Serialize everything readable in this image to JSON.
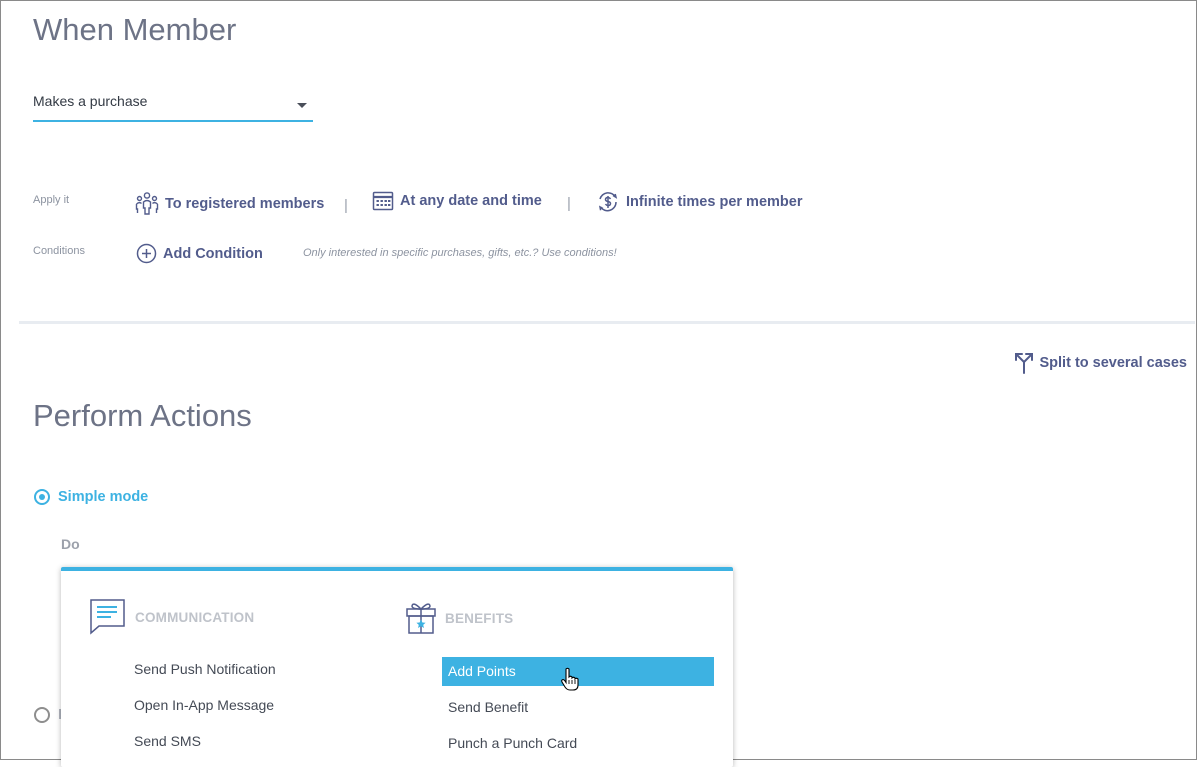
{
  "when": {
    "title": "When Member",
    "trigger_value": "Makes a purchase"
  },
  "apply": {
    "label": "Apply it",
    "members": "To registered members",
    "date": "At any date and time",
    "frequency": "Infinite times per member",
    "separator": "|"
  },
  "conditions": {
    "label": "Conditions",
    "add": "Add Condition",
    "hint": "Only interested in specific purchases, gifts, etc.? Use conditions!"
  },
  "split_label": "Split to several cases",
  "perform": {
    "title": "Perform Actions",
    "simple_mode": "Simple mode",
    "second_mode_partial": "I",
    "do_label": "Do"
  },
  "dropdown": {
    "communication": {
      "heading": "COMMUNICATION",
      "items": [
        "Send Push Notification",
        "Open In-App Message",
        "Send SMS"
      ]
    },
    "benefits": {
      "heading": "BENEFITS",
      "items": [
        "Add Points",
        "Send Benefit",
        "Punch a Punch Card"
      ],
      "selected_index": 0
    }
  },
  "colors": {
    "accent": "#3db2e2",
    "link": "#525c8c",
    "title": "#6d7386"
  }
}
